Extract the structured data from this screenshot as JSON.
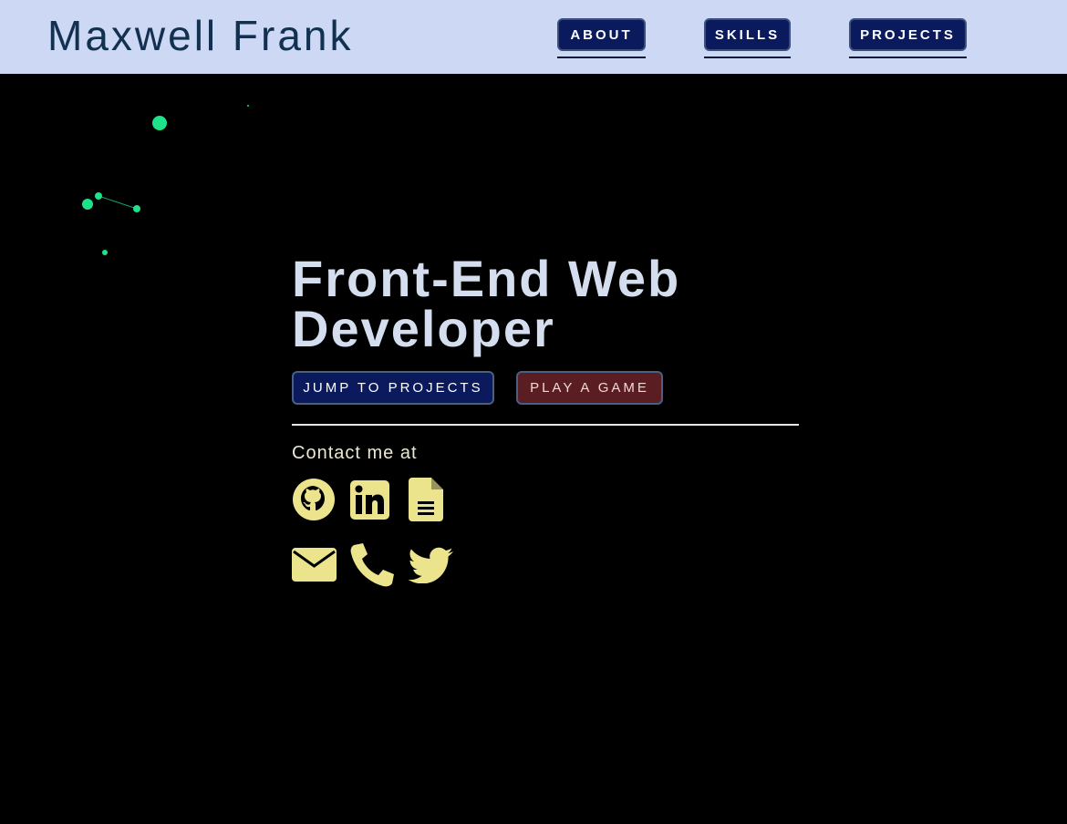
{
  "header": {
    "name": "Maxwell Frank",
    "nav": [
      {
        "label": "ABOUT"
      },
      {
        "label": "SKILLS"
      },
      {
        "label": "PROJECTS"
      }
    ]
  },
  "hero": {
    "title_line1": "Front-End Web",
    "title_line2": "Developer",
    "jump_label": "JUMP TO PROJECTS",
    "game_label": "PLAY A GAME"
  },
  "contact": {
    "label": "Contact me at",
    "icons": [
      "github-icon",
      "linkedin-icon",
      "resume-icon",
      "email-icon",
      "phone-icon",
      "twitter-icon"
    ]
  },
  "colors": {
    "header_bg": "#cdd8f5",
    "nav_button": "#0a1a5c",
    "game_button": "#5a1e22",
    "icon": "#ece48c",
    "particle": "#1de38a"
  }
}
